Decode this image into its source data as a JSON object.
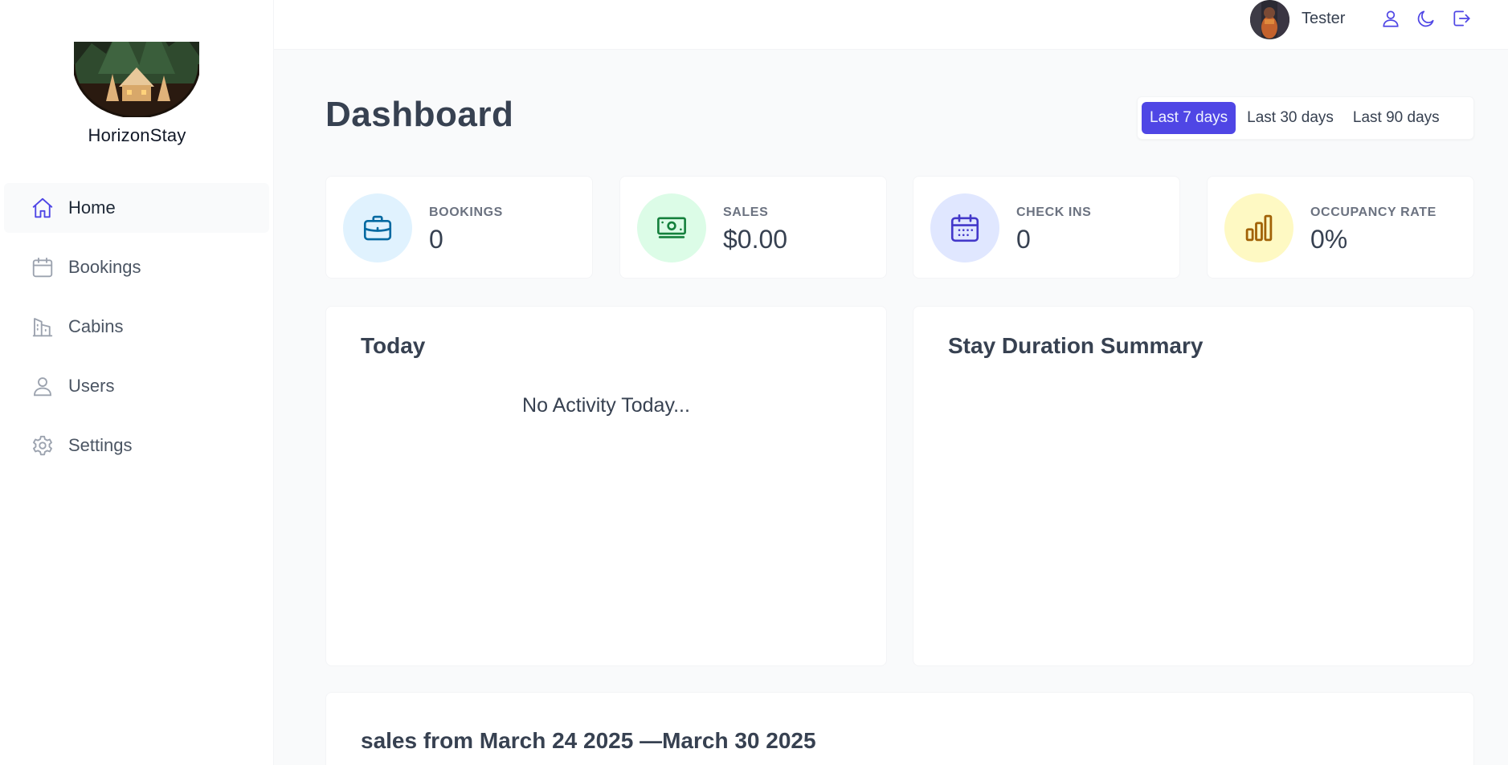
{
  "brand": {
    "name": "HorizonStay"
  },
  "nav": {
    "items": [
      {
        "label": "Home",
        "icon": "home-icon",
        "active": true
      },
      {
        "label": "Bookings",
        "icon": "calendar-icon",
        "active": false
      },
      {
        "label": "Cabins",
        "icon": "building-icon",
        "active": false
      },
      {
        "label": "Users",
        "icon": "user-icon",
        "active": false
      },
      {
        "label": "Settings",
        "icon": "gear-icon",
        "active": false
      }
    ]
  },
  "header": {
    "username": "Tester",
    "icons": [
      "user-icon",
      "moon-icon",
      "logout-icon"
    ]
  },
  "page": {
    "title": "Dashboard"
  },
  "filter": {
    "options": [
      "Last 7 days",
      "Last 30 days",
      "Last 90 days"
    ],
    "selected": "Last 7 days"
  },
  "stats": [
    {
      "label": "BOOKINGS",
      "value": "0",
      "icon": "briefcase-icon",
      "bg": "#e0f2fe",
      "fg": "#0369a1"
    },
    {
      "label": "SALES",
      "value": "$0.00",
      "icon": "banknotes-icon",
      "bg": "#dcfce7",
      "fg": "#15803d"
    },
    {
      "label": "CHECK INS",
      "value": "0",
      "icon": "calendar-days-icon",
      "bg": "#e0e7ff",
      "fg": "#4338ca"
    },
    {
      "label": "OCCUPANCY RATE",
      "value": "0%",
      "icon": "chart-bar-icon",
      "bg": "#fef9c3",
      "fg": "#a16207"
    }
  ],
  "today": {
    "title": "Today",
    "empty_message": "No Activity Today..."
  },
  "duration": {
    "title": "Stay Duration Summary"
  },
  "sales": {
    "title": "sales from March 24 2025 —March 30 2025"
  },
  "colors": {
    "accent": "#4f46e5",
    "icon_nav": "#4f46e5",
    "icon_muted": "#9ca3af"
  }
}
